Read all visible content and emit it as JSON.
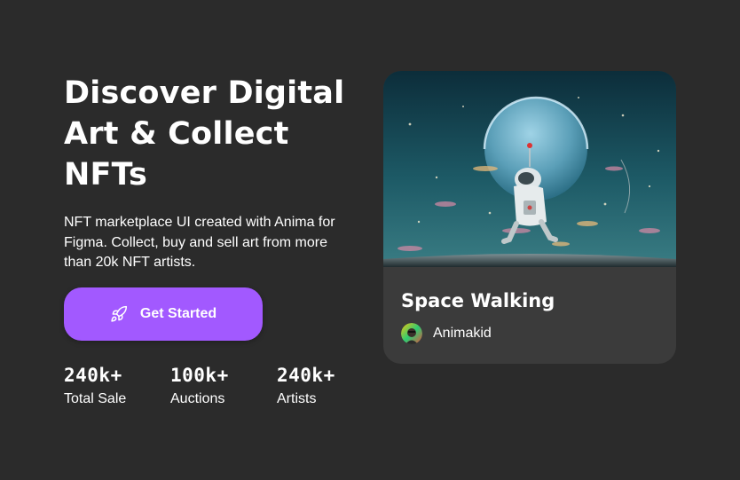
{
  "hero": {
    "title": "Discover Digital\nArt & Collect\nNFTs",
    "subtitle": "NFT marketplace UI created with Anima for Figma. Collect, buy and sell art from more than 20k NFT artists.",
    "cta_label": "Get Started",
    "cta_icon": "rocket-icon"
  },
  "stats": [
    {
      "value": "240k+",
      "label": "Total Sale"
    },
    {
      "value": "100k+",
      "label": "Auctions"
    },
    {
      "value": "240k+",
      "label": "Artists"
    }
  ],
  "featured_nft": {
    "title": "Space Walking",
    "artist": "Animakid"
  },
  "colors": {
    "background": "#2b2b2b",
    "card": "#3b3b3b",
    "accent": "#a259ff",
    "text": "#ffffff"
  }
}
